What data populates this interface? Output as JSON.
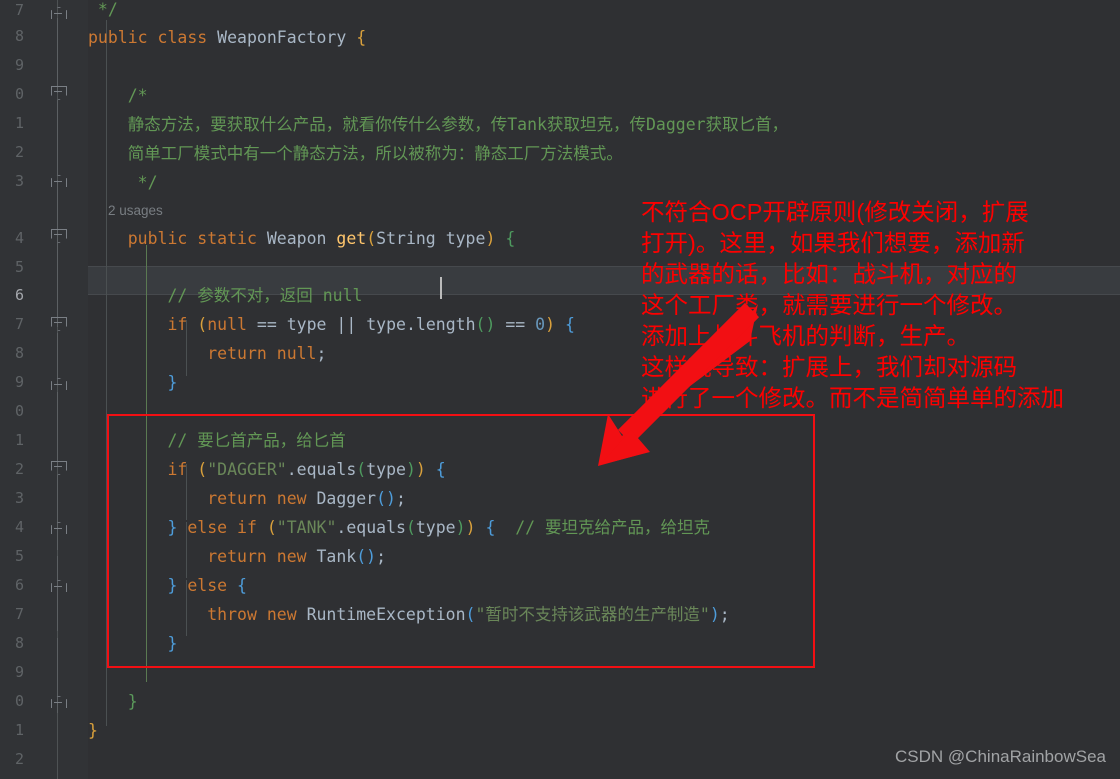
{
  "editor": {
    "theme_background": "#2f3033",
    "gutter_background": "#313336",
    "current_line_background": "#393c40",
    "accent_annotation_color": "#fe0000"
  },
  "gutter": {
    "line_numbers": [
      "7",
      "8",
      "9",
      "0",
      "1",
      "2",
      "3",
      "4",
      "5",
      "6",
      "7",
      "8",
      "9",
      "0",
      "1",
      "2",
      "3",
      "4",
      "5",
      "6",
      "7",
      "8",
      "9",
      "0",
      "1",
      "2"
    ],
    "current_line_index": 9
  },
  "inlay_hints": {
    "usages": "2 usages"
  },
  "code_lines": [
    {
      "n": "7",
      "text": " */"
    },
    {
      "n": "8",
      "text": "public class WeaponFactory {"
    },
    {
      "n": "9",
      "text": ""
    },
    {
      "n": "0",
      "text": "    /*"
    },
    {
      "n": "1",
      "text": "    静态方法，要获取什么产品，就看你传什么参数，传Tank获取坦克，传Dagger获取匕首，"
    },
    {
      "n": "2",
      "text": "    简单工厂模式中有一个静态方法，所以被称为：静态工厂方法模式。"
    },
    {
      "n": "3",
      "text": "     */"
    },
    {
      "n": "4",
      "text": "    public static Weapon get(String type) {"
    },
    {
      "n": "5",
      "text": ""
    },
    {
      "n": "6",
      "text": "        // 参数不对，返回 null"
    },
    {
      "n": "7",
      "text": "        if (null == type || type.length() == 0) {"
    },
    {
      "n": "8",
      "text": "            return null;"
    },
    {
      "n": "9",
      "text": "        }"
    },
    {
      "n": "0",
      "text": ""
    },
    {
      "n": "1",
      "text": "        // 要匕首产品，给匕首"
    },
    {
      "n": "2",
      "text": "        if (\"DAGGER\".equals(type)) {"
    },
    {
      "n": "3",
      "text": "            return new Dagger();"
    },
    {
      "n": "4",
      "text": "        } else if (\"TANK\".equals(type)) {  // 要坦克给产品，给坦克"
    },
    {
      "n": "5",
      "text": "            return new Tank();"
    },
    {
      "n": "6",
      "text": "        } else {"
    },
    {
      "n": "7",
      "text": "            throw new RuntimeException(\"暂时不支持该武器的生产制造\");"
    },
    {
      "n": "8",
      "text": "        }"
    },
    {
      "n": "9",
      "text": ""
    },
    {
      "n": "0",
      "text": "    }"
    },
    {
      "n": "1",
      "text": "}"
    },
    {
      "n": "2",
      "text": ""
    }
  ],
  "annotation": {
    "color": "#fe0000",
    "lines": [
      "不符合OCP开辟原则(修改关闭，扩展",
      "打开)。这里，如果我们想要，添加新",
      "的武器的话，比如：战斗机，对应的",
      "这个工厂类，就需要进行一个修改。",
      "添加上战斗飞机的判断，生产。",
      "这样就导致：扩展上，我们却对源码",
      "进行了一个修改。而不是简简单单的添加"
    ],
    "arrow_label": "red-arrow-pointing-to-factory-branching-code",
    "box_label": "red-highlight-rectangle-around-if-else-chain"
  },
  "watermark": {
    "text": "CSDN @ChinaRainbowSea"
  }
}
